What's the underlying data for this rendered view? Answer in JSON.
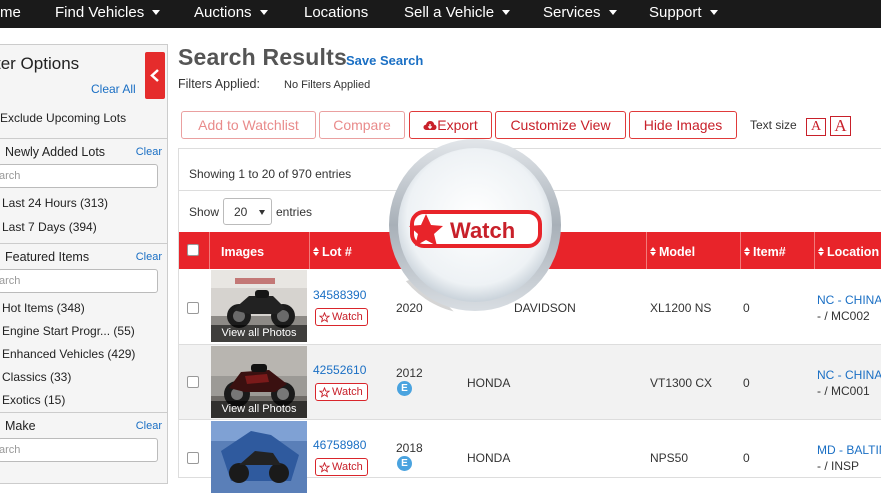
{
  "nav": {
    "items": [
      {
        "label": "me",
        "caret": false
      },
      {
        "label": "Find Vehicles",
        "caret": true
      },
      {
        "label": "Auctions",
        "caret": true
      },
      {
        "label": "Locations",
        "caret": false
      },
      {
        "label": "Sell a Vehicle",
        "caret": true
      },
      {
        "label": "Services",
        "caret": true
      },
      {
        "label": "Support",
        "caret": true
      }
    ]
  },
  "sidebar": {
    "title": "ter Options",
    "clear_all": "Clear All",
    "exclude": "Exclude Upcoming Lots",
    "sections": [
      {
        "title": "Newly Added Lots",
        "clear": "Clear",
        "search": "arch",
        "items": [
          "Last 24 Hours (313)",
          "Last 7 Days (394)"
        ]
      },
      {
        "title": "Featured Items",
        "clear": "Clear",
        "search": "arch",
        "items": [
          "Hot Items (348)",
          "Engine Start Progr... (55)",
          "Enhanced Vehicles (429)",
          "Classics (33)",
          "Exotics (15)"
        ]
      },
      {
        "title": "Make",
        "clear": "Clear",
        "search": "arch",
        "items": []
      }
    ]
  },
  "main": {
    "title": "Search Results",
    "save_search": "Save Search",
    "filters_label": "Filters Applied:",
    "filters_value": "No Filters Applied"
  },
  "toolbar": {
    "add_watchlist": "Add to Watchlist",
    "compare": "Compare",
    "export": "Export",
    "customize": "Customize View",
    "hide_images": "Hide Images",
    "text_size": "Text size",
    "text_small": "A",
    "text_large": "A"
  },
  "table": {
    "showing": "Showing 1 to 20 of 970 entries",
    "show_label": "Show",
    "page_size": "20",
    "entries_label": "entries",
    "headers": {
      "images": "Images",
      "lot": "Lot #",
      "model": "Model",
      "item": "Item#",
      "location": "Location"
    },
    "view_photos": "View all Photos",
    "watch": "Watch",
    "rows": [
      {
        "lot": "34588390",
        "year": "2020",
        "make": "DAVIDSON",
        "model": "XL1200 NS",
        "item": "0",
        "loc1": "NC - CHINA",
        "loc2": "- / MC002",
        "badge": ""
      },
      {
        "lot": "42552610",
        "year": "2012",
        "make": "HONDA",
        "model": "VT1300 CX",
        "item": "0",
        "loc1": "NC - CHINA",
        "loc2": "- / MC001",
        "badge": "E"
      },
      {
        "lot": "46758980",
        "year": "2018",
        "make": "HONDA",
        "model": "NPS50",
        "item": "0",
        "loc1": "MD - BALTIM",
        "loc2": "- / INSP",
        "badge": "E"
      }
    ]
  },
  "magnifier": {
    "label": "Watch"
  },
  "colors": {
    "brand_red": "#e8242a",
    "link_blue": "#1a6fc4",
    "nav_bg": "#1a1a1a"
  }
}
